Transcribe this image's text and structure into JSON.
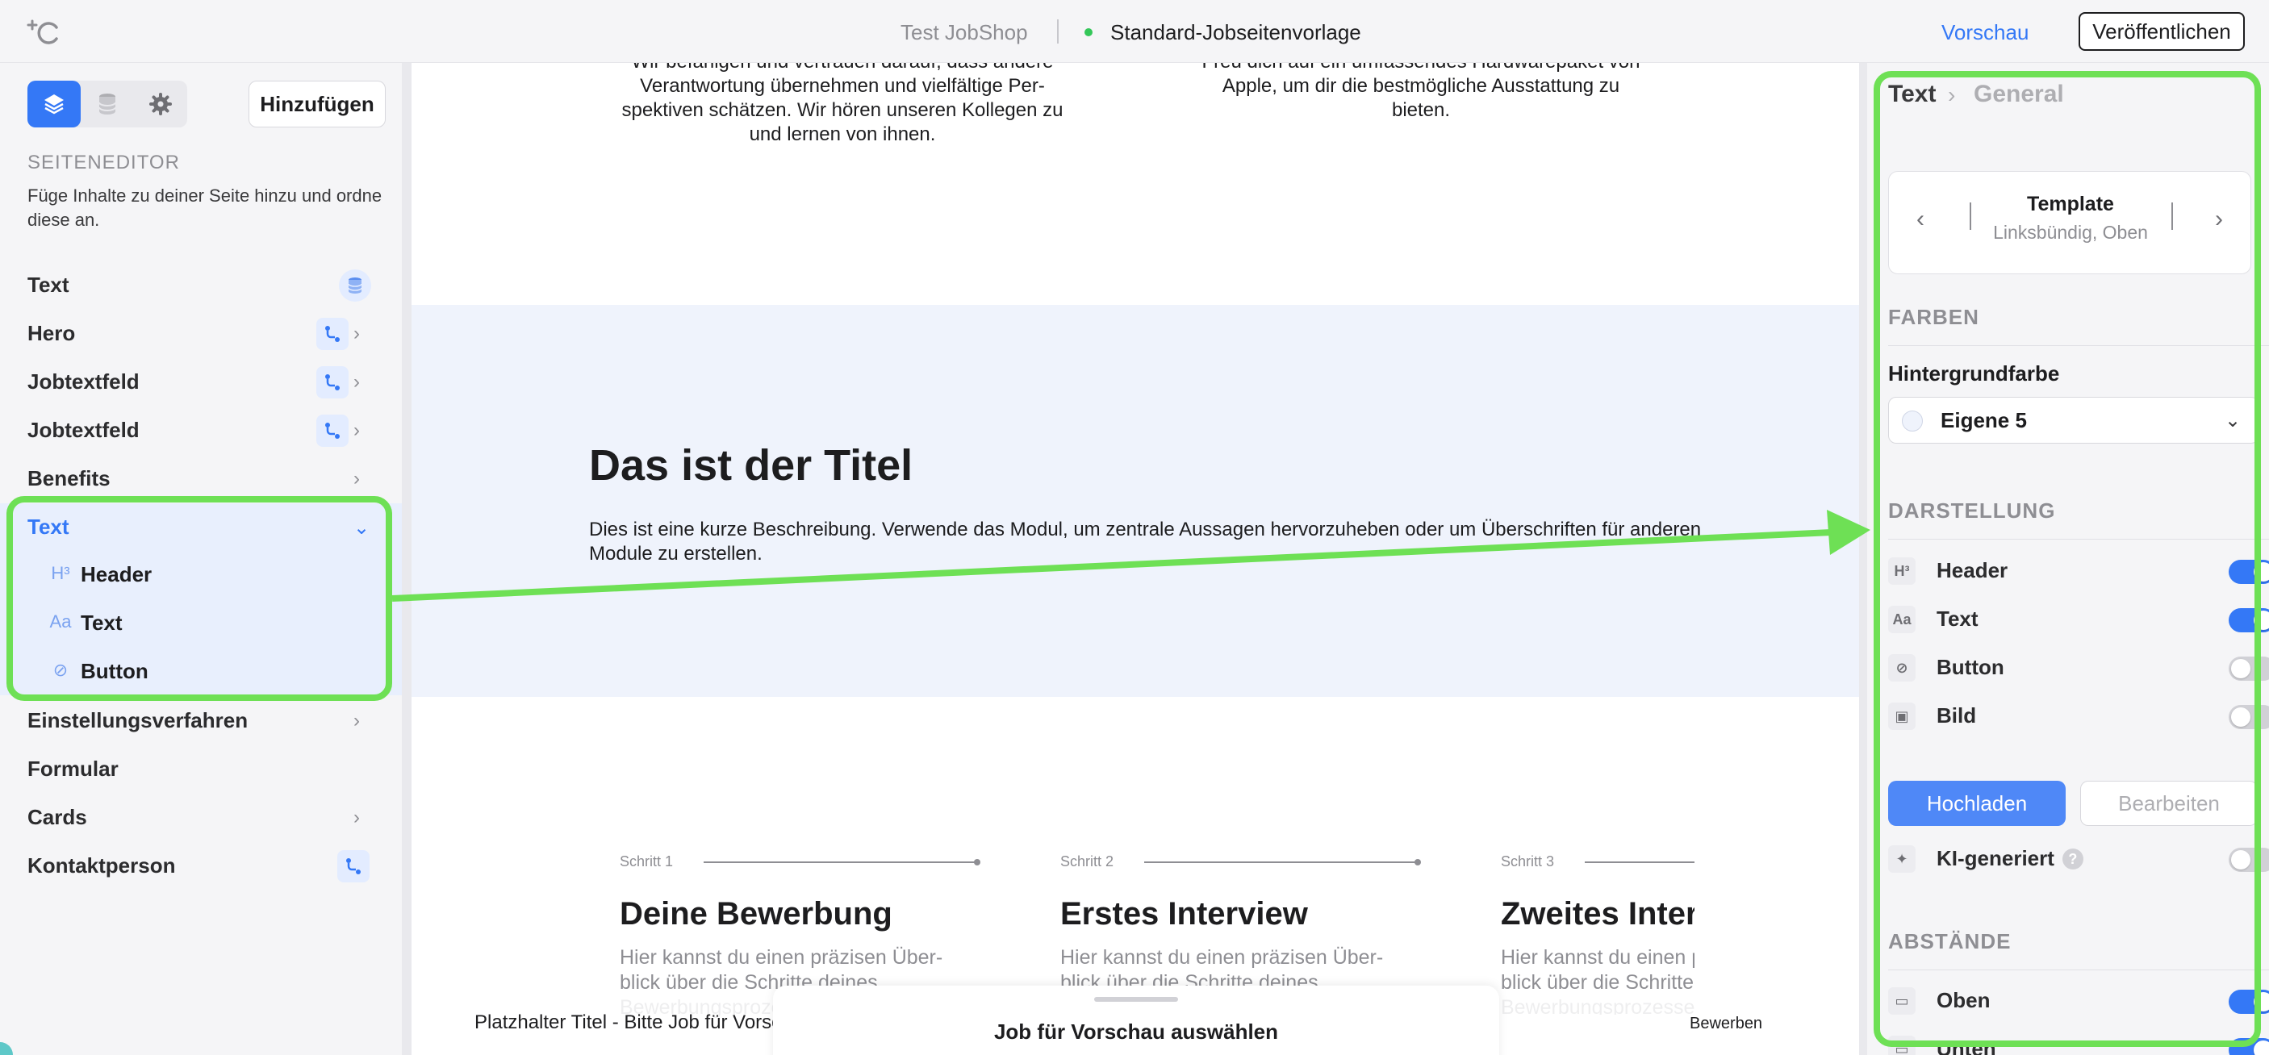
{
  "topbar": {
    "shop_name": "Test JobShop",
    "template_name": "Standard-Jobseitenvorlage",
    "preview": "Vorschau",
    "publish": "Veröffentlichen"
  },
  "sidebar": {
    "add_button": "Hinzufügen",
    "section_title": "SEITENEDITOR",
    "section_desc": "Füge Inhalte zu deiner Seite hinzu und ordne diese an.",
    "modules": [
      {
        "label": "Text"
      },
      {
        "label": "Hero"
      },
      {
        "label": "Jobtextfeld"
      },
      {
        "label": "Jobtextfeld"
      },
      {
        "label": "Benefits"
      },
      {
        "label": "Text"
      },
      {
        "label": "Einstellungsverfahren"
      },
      {
        "label": "Formular"
      },
      {
        "label": "Cards"
      },
      {
        "label": "Kontaktperson"
      }
    ],
    "subitems": [
      {
        "icon": "H³",
        "label": "Header"
      },
      {
        "icon": "Aa",
        "label": "Text"
      },
      {
        "icon": "⊘",
        "label": "Button"
      }
    ]
  },
  "canvas": {
    "top_left_text": "Wir befähigen und vertrauen darauf, dass andere Verantwortung übernehmen und vielfältige Per-spektiven schätzen. Wir hören unseren Kollegen zu und lernen von ihnen.",
    "top_right_text": "Freu dich auf ein umfassendes Hardwarepaket von Apple, um dir die bestmögliche Ausstattung zu bieten.",
    "band_title": "Das ist der Titel",
    "band_desc": "Dies ist eine kurze Beschreibung. Verwende das Modul, um zentrale Aussagen hervorzuheben oder um Überschriften für anderen Module zu erstellen.",
    "steps": [
      {
        "num": "Schritt 1",
        "title": "Deine Bewerbung",
        "text": "Hier kannst du einen präzisen Über-blick über die Schritte deines Bewerbungsprozesses geben."
      },
      {
        "num": "Schritt 2",
        "title": "Erstes Interview",
        "text": "Hier kannst du einen präzisen Über-blick über die Schritte deines Bewerbungsprozesses geben."
      },
      {
        "num": "Schritt 3",
        "title": "Zweites Interview",
        "text": "Hier kannst du einen präzisen Über-blick über die Schritte deines Bewerbungsprozesses geben."
      }
    ],
    "placeholder_title": "Platzhalter Titel - Bitte Job für Vorschau auswählen",
    "apply": "Bewerben",
    "job_select": "Job für Vorschau auswählen"
  },
  "panel": {
    "breadcrumb_1": "Text",
    "breadcrumb_2": "General",
    "template_title": "Template",
    "template_sub": "Linksbündig, Oben",
    "colors_title": "FARBEN",
    "bg_label": "Hintergrundfarbe",
    "bg_value": "Eigene 5",
    "display_title": "DARSTELLUNG",
    "toggles": [
      {
        "icon": "H³",
        "label": "Header",
        "on": true
      },
      {
        "icon": "Aa",
        "label": "Text",
        "on": true
      },
      {
        "icon": "⊘",
        "label": "Button",
        "on": false
      },
      {
        "icon": "▣",
        "label": "Bild",
        "on": false
      }
    ],
    "upload": "Hochladen",
    "edit": "Bearbeiten",
    "ai_label": "KI-generiert",
    "ai_help": "?",
    "spacing_title": "ABSTÄNDE",
    "spacing_top": "Oben",
    "spacing_bottom": "Unten"
  },
  "colors": {
    "accent": "#3478f6",
    "highlight": "#6ee055",
    "band_bg": "#eff3fc"
  }
}
